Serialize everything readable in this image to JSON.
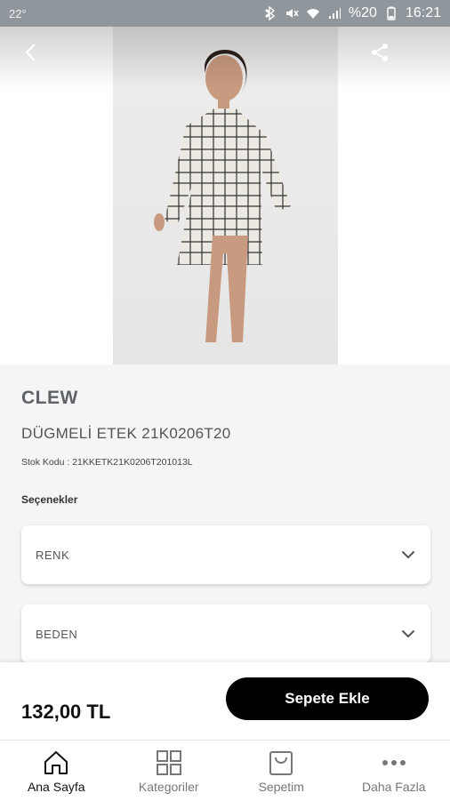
{
  "status_bar": {
    "temperature": "22°",
    "battery": "%20",
    "time": "16:21"
  },
  "product": {
    "brand": "CLEW",
    "name": "DÜGMELİ ETEK 21K0206T20",
    "sku": "Stok Kodu : 21KKETK21K0206T201013L",
    "options_label": "Seçenekler",
    "options": [
      {
        "label": "RENK"
      },
      {
        "label": "BEDEN"
      }
    ],
    "price": "132,00 TL"
  },
  "cart_button_label": "Sepete Ekle",
  "tabs": [
    {
      "label": "Ana Sayfa",
      "icon": "home-icon",
      "active": true
    },
    {
      "label": "Kategoriler",
      "icon": "grid-icon",
      "active": false
    },
    {
      "label": "Sepetim",
      "icon": "bag-icon",
      "active": false
    },
    {
      "label": "Daha Fazla",
      "icon": "more-icon",
      "active": false
    }
  ]
}
